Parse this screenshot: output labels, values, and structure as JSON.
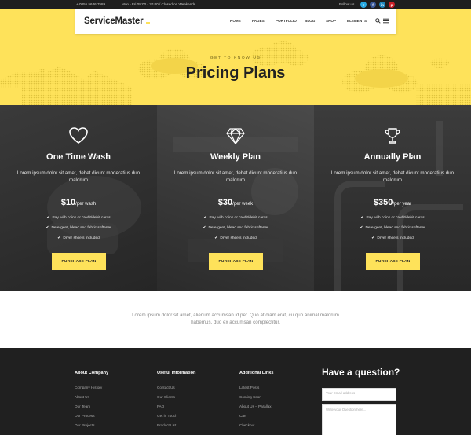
{
  "topbar": {
    "phone": "+ 0855 5646 7589",
    "hours": "Mon - Fri 08:00 - 20:00 / Closed on Weekends",
    "follow_label": "Follow us",
    "social": [
      {
        "icon": "twitter-icon",
        "glyph": "t",
        "color": "#29a9e1"
      },
      {
        "icon": "facebook-icon",
        "glyph": "f",
        "color": "#3b5998"
      },
      {
        "icon": "linkedin-icon",
        "glyph": "in",
        "color": "#1f88be"
      },
      {
        "icon": "pinterest-icon",
        "glyph": "p",
        "color": "#cb2027"
      }
    ]
  },
  "header": {
    "logo": "ServiceMaster",
    "nav": [
      "HOME",
      "PAGES",
      "PORTFOLIO",
      "BLOG",
      "SHOP",
      "ELEMENTS"
    ],
    "search_icon": "search-icon",
    "menu_icon": "hamburger-icon"
  },
  "hero": {
    "eyebrow": "GET TO KNOW US",
    "title": "Pricing Plans"
  },
  "plans": [
    {
      "icon": "heart-icon",
      "name": "One Time Wash",
      "description": "Lorem ipsum dolor sit amet, debet dicunt moderatius duo malorum",
      "price": "$10",
      "period": "/per wash",
      "features": [
        "Pay with coins or credit/debit cards",
        "Detergent, bleac and fabric softaner",
        "Dryer sheets included"
      ],
      "button": "PURCHASE PLAN"
    },
    {
      "icon": "diamond-icon",
      "name": "Weekly Plan",
      "description": "Lorem ipsum dolor sit amet, debet dicunt moderatius duo malorum",
      "price": "$30",
      "period": "/per week",
      "features": [
        "Pay with coins or credit/debit cards",
        "Detergent, bleac and fabric softaner",
        "Dryer sheets included"
      ],
      "button": "PURCHASE PLAN"
    },
    {
      "icon": "trophy-icon",
      "name": "Annually Plan",
      "description": "Lorem ipsum dolor sit amet, debet dicunt moderatius duo malorum",
      "price": "$350",
      "period": "/per year",
      "features": [
        "Pay with coins or credit/debit cards",
        "Detergent, bleac and fabric softaner",
        "Dryer sheets included"
      ],
      "button": "PURCHASE PLAN"
    }
  ],
  "intro": {
    "text": "Lorem ipsum dolor sit amet, alienum accumsan id per. Quo at diam erat, cu quo animal malorum habemus, duo ex accumsan complectitur."
  },
  "footer": {
    "columns": [
      {
        "heading": "About Company",
        "links": [
          "Company History",
          "About Us",
          "Our Team",
          "Our Process",
          "Our Projects"
        ]
      },
      {
        "heading": "Useful Information",
        "links": [
          "Contact Us",
          "Our Clients",
          "FAQ",
          "Get in Touch",
          "Product List"
        ]
      },
      {
        "heading": "Additional Links",
        "links": [
          "Latest Posts",
          "Coming Soon",
          "About Us – Parallax",
          "Cart",
          "Checkout"
        ]
      }
    ],
    "question_heading": "Have a question?",
    "email_placeholder": "Your Email address",
    "message_placeholder": "Write your Question here..."
  },
  "colors": {
    "accent": "#fee25a",
    "dark": "#2f2f2f",
    "footer": "#202020"
  }
}
